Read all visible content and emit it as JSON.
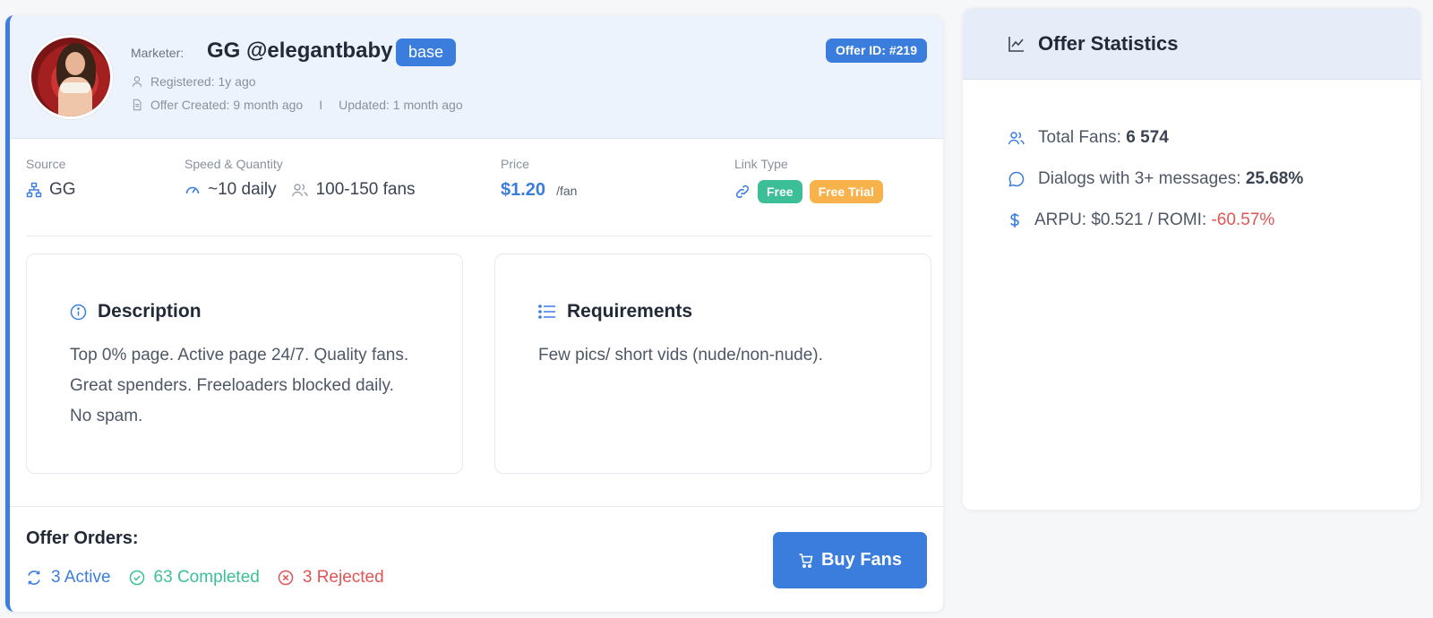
{
  "offer": {
    "marketer_label": "Marketer:",
    "marketer_name": "GG @elegantbaby",
    "tier_badge": "base",
    "offer_id": "Offer ID: #219",
    "registered": "Registered: 1y ago",
    "created": "Offer Created: 9 month ago",
    "separator": "I",
    "updated": "Updated: 1 month ago",
    "info": {
      "source_label": "Source",
      "source_value": "GG",
      "speed_label": "Speed & Quantity",
      "speed_value": "~10 daily",
      "quantity_value": "100-150 fans",
      "price_label": "Price",
      "price_value": "$1.20",
      "price_unit": "/fan",
      "link_type_label": "Link Type",
      "link_free": "Free",
      "link_trial": "Free Trial"
    },
    "description": {
      "title": "Description",
      "text": "Top 0% page. Active page 24/7. Quality fans. Great spenders. Freeloaders blocked daily. No spam."
    },
    "requirements": {
      "title": "Requirements",
      "text": "Few pics/ short vids (nude/non-nude)."
    },
    "orders": {
      "title": "Offer Orders:",
      "active": "3 Active",
      "completed": "63 Completed",
      "rejected": "3 Rejected",
      "buy_label": "Buy Fans"
    }
  },
  "stats": {
    "title": "Offer Statistics",
    "total_fans_label": "Total Fans:",
    "total_fans_value": "6 574",
    "dialogs_label": "Dialogs with 3+ messages:",
    "dialogs_value": "25.68%",
    "arpu_label": "ARPU: $0.521 / ROMI:",
    "romi_value": "-60.57%"
  },
  "colors": {
    "accent": "#3b7ddd",
    "success": "#3cbf97",
    "warning": "#f7b24b",
    "danger": "#e05555"
  }
}
